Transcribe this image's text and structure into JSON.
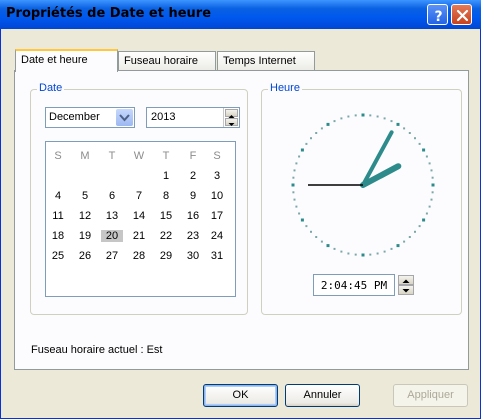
{
  "window": {
    "title": "Propriétés de Date et heure",
    "help_icon": "question-icon",
    "close_icon": "close-icon"
  },
  "tabs": [
    {
      "label": "Date et heure",
      "active": true
    },
    {
      "label": "Fuseau horaire",
      "active": false
    },
    {
      "label": "Temps Internet",
      "active": false
    }
  ],
  "date_group": {
    "label": "Date",
    "month": "December",
    "year": "2013"
  },
  "calendar": {
    "weekdays": [
      "S",
      "M",
      "T",
      "W",
      "T",
      "F",
      "S"
    ],
    "weeks": [
      [
        "",
        "",
        "",
        "",
        "1",
        "2",
        "3"
      ],
      [
        "4",
        "5",
        "6",
        "7",
        "8",
        "9",
        "10"
      ],
      [
        "11",
        "12",
        "13",
        "14",
        "15",
        "16",
        "17"
      ],
      [
        "18",
        "19",
        "20",
        "21",
        "22",
        "23",
        "24"
      ],
      [
        "25",
        "26",
        "27",
        "28",
        "29",
        "30",
        "31"
      ]
    ],
    "selected_day": "20"
  },
  "time_group": {
    "label": "Heure",
    "time": "2:04:45 PM",
    "hours": 2,
    "minutes": 4,
    "seconds": 45
  },
  "timezone_status": "Fuseau horaire actuel : Est",
  "buttons": {
    "ok": "OK",
    "cancel": "Annuler",
    "apply": "Appliquer"
  },
  "colors": {
    "titlebar": "#0058ee",
    "accent_tab": "#ffc83c",
    "group_label": "#0046d5",
    "clock_hands": "#2e8b8b"
  }
}
